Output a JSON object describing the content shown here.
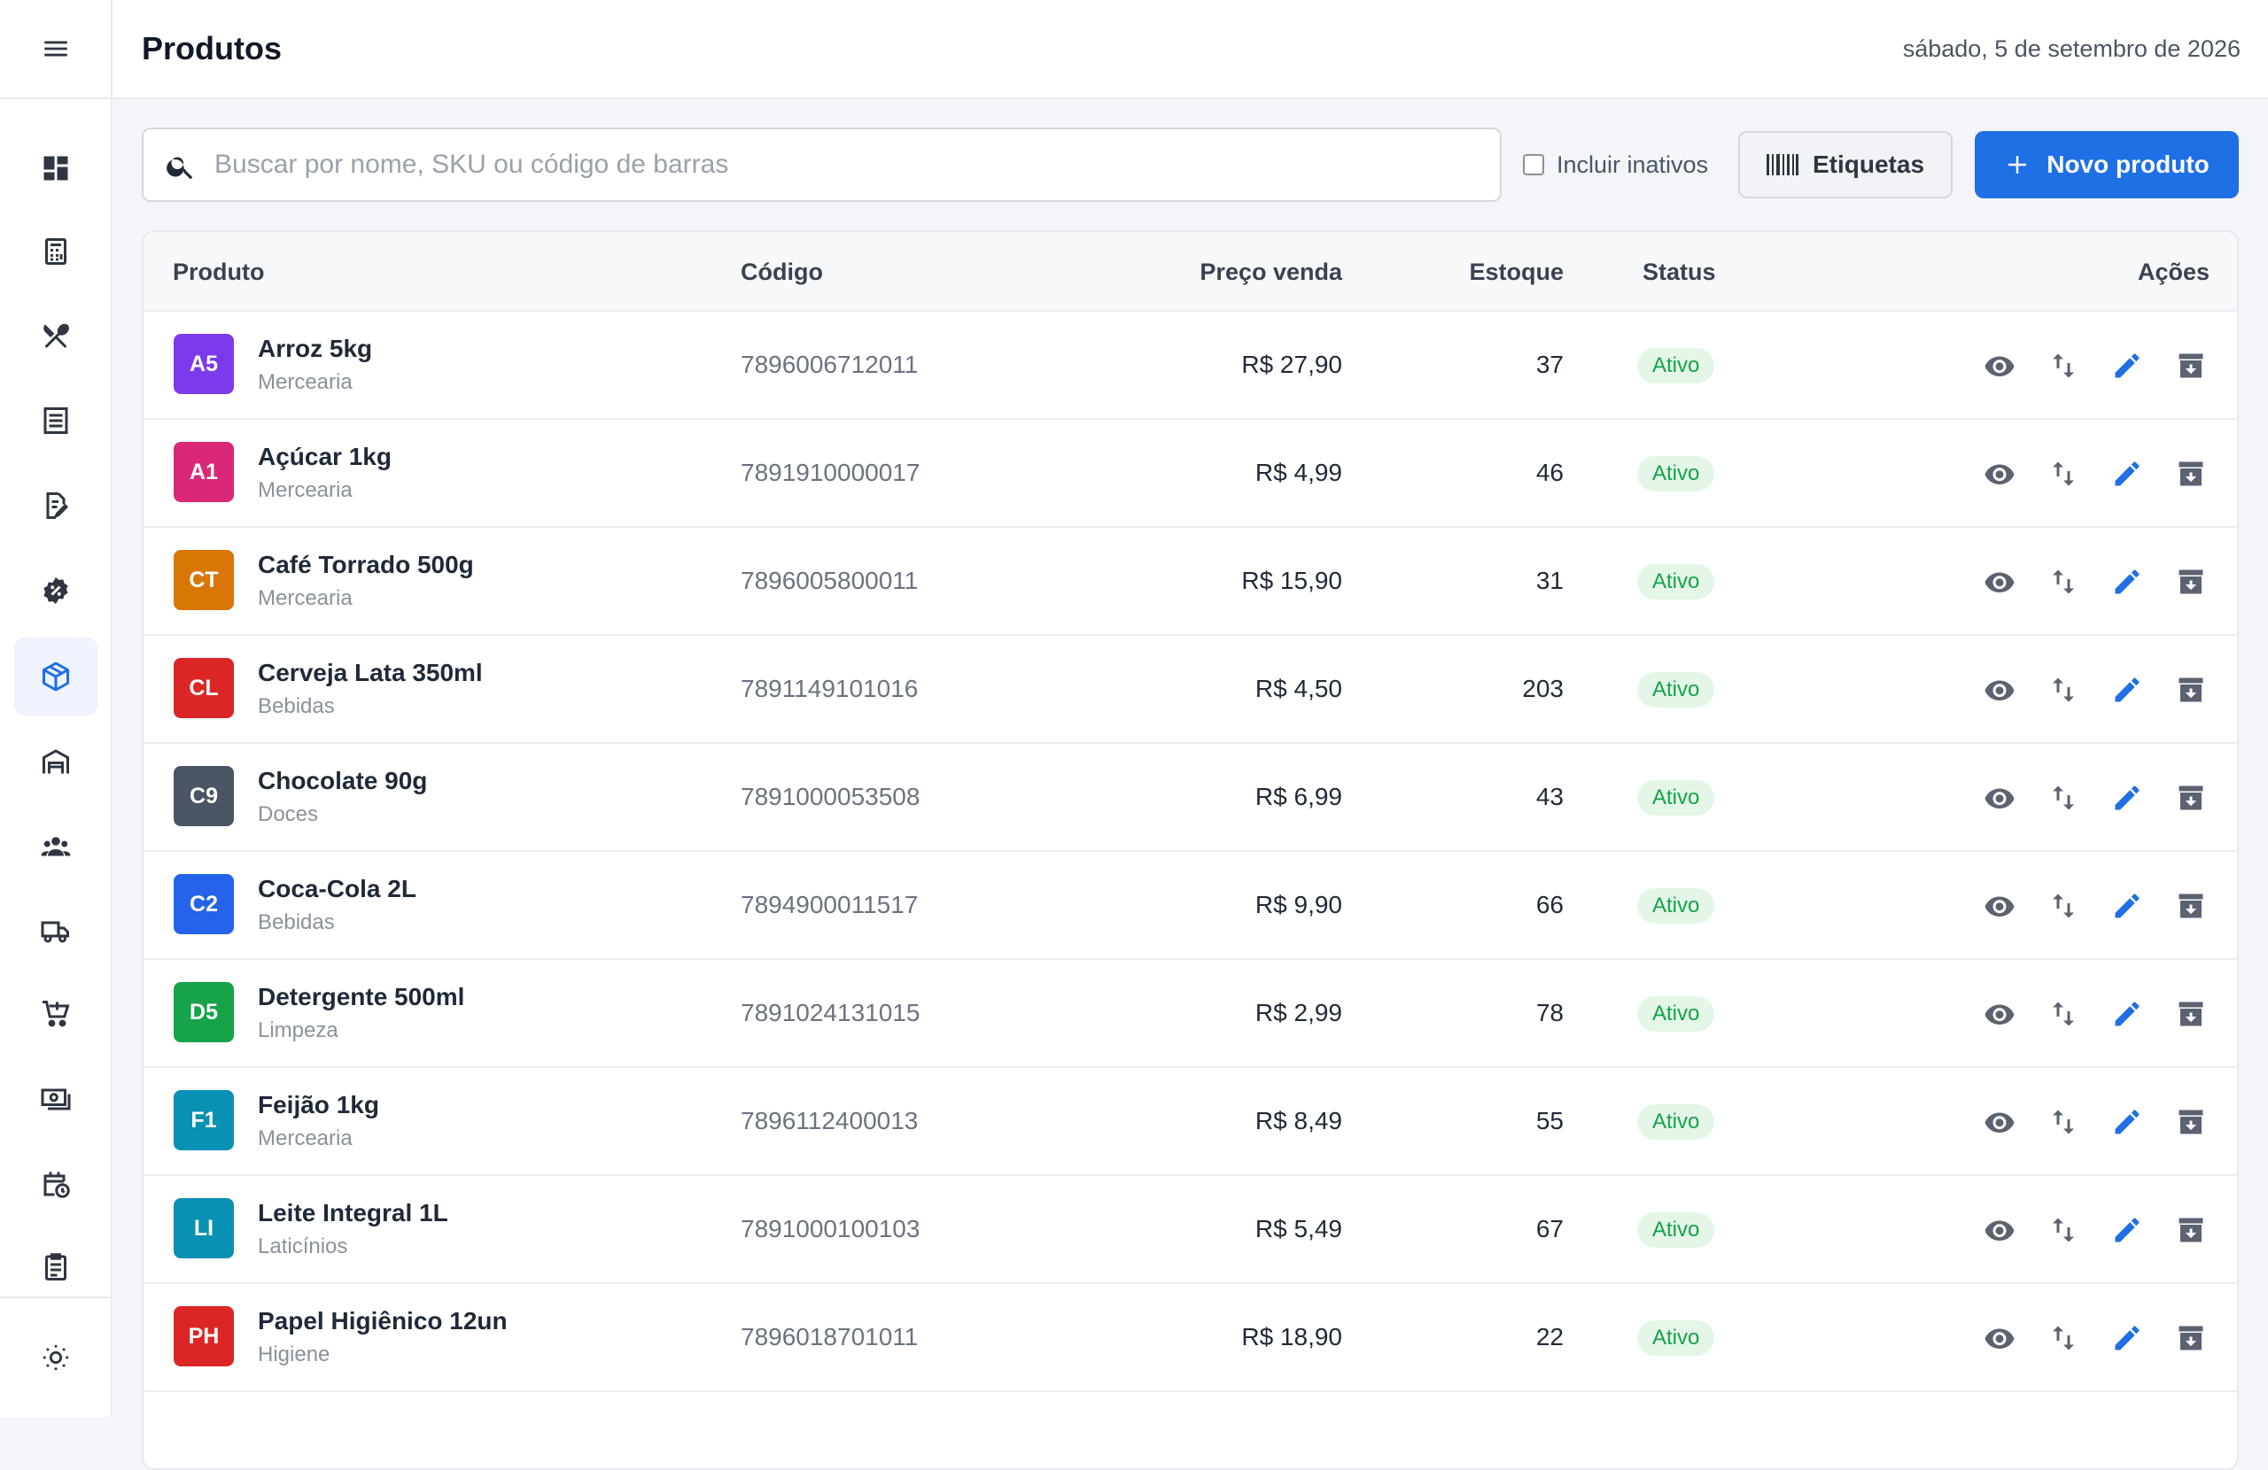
{
  "header": {
    "title": "Produtos",
    "date": "sábado, 5 de setembro de 2026"
  },
  "sidebar": {
    "items": [
      {
        "icon": "dashboard-icon"
      },
      {
        "icon": "calculator-icon"
      },
      {
        "icon": "restaurant-icon"
      },
      {
        "icon": "list-icon"
      },
      {
        "icon": "edit-document-icon"
      },
      {
        "icon": "discount-badge-icon"
      },
      {
        "icon": "box-icon",
        "active": true
      },
      {
        "icon": "warehouse-icon"
      },
      {
        "icon": "users-icon"
      },
      {
        "icon": "truck-icon"
      },
      {
        "icon": "cart-add-icon"
      },
      {
        "icon": "cash-icon"
      },
      {
        "icon": "calendar-clock-icon"
      },
      {
        "icon": "clipboard-icon"
      }
    ],
    "bottom_icon": "theme-sun-icon"
  },
  "toolbar": {
    "search_placeholder": "Buscar por nome, SKU ou código de barras",
    "include_inactive_label": "Incluir inativos",
    "labels_button": "Etiquetas",
    "new_product_button": "Novo produto"
  },
  "table": {
    "columns": {
      "product": "Produto",
      "code": "Código",
      "price": "Preço venda",
      "stock": "Estoque",
      "status": "Status",
      "actions": "Ações"
    },
    "rows": [
      {
        "initials": "A5",
        "color": "#7c3aed",
        "name": "Arroz 5kg",
        "category": "Mercearia",
        "code": "7896006712011",
        "price": "R$ 27,90",
        "stock": "37",
        "status": "Ativo"
      },
      {
        "initials": "A1",
        "color": "#db2777",
        "name": "Açúcar 1kg",
        "category": "Mercearia",
        "code": "7891910000017",
        "price": "R$ 4,99",
        "stock": "46",
        "status": "Ativo"
      },
      {
        "initials": "CT",
        "color": "#d97706",
        "name": "Café Torrado 500g",
        "category": "Mercearia",
        "code": "7896005800011",
        "price": "R$ 15,90",
        "stock": "31",
        "status": "Ativo"
      },
      {
        "initials": "CL",
        "color": "#dc2626",
        "name": "Cerveja Lata 350ml",
        "category": "Bebidas",
        "code": "7891149101016",
        "price": "R$ 4,50",
        "stock": "203",
        "status": "Ativo"
      },
      {
        "initials": "C9",
        "color": "#4b5563",
        "name": "Chocolate 90g",
        "category": "Doces",
        "code": "7891000053508",
        "price": "R$ 6,99",
        "stock": "43",
        "status": "Ativo"
      },
      {
        "initials": "C2",
        "color": "#2563eb",
        "name": "Coca-Cola 2L",
        "category": "Bebidas",
        "code": "7894900011517",
        "price": "R$ 9,90",
        "stock": "66",
        "status": "Ativo"
      },
      {
        "initials": "D5",
        "color": "#16a34a",
        "name": "Detergente 500ml",
        "category": "Limpeza",
        "code": "7891024131015",
        "price": "R$ 2,99",
        "stock": "78",
        "status": "Ativo"
      },
      {
        "initials": "F1",
        "color": "#0891b2",
        "name": "Feijão 1kg",
        "category": "Mercearia",
        "code": "7896112400013",
        "price": "R$ 8,49",
        "stock": "55",
        "status": "Ativo"
      },
      {
        "initials": "LI",
        "color": "#0891b2",
        "name": "Leite Integral 1L",
        "category": "Laticínios",
        "code": "7891000100103",
        "price": "R$ 5,49",
        "stock": "67",
        "status": "Ativo"
      },
      {
        "initials": "PH",
        "color": "#dc2626",
        "name": "Papel Higiênico 12un",
        "category": "Higiene",
        "code": "7896018701011",
        "price": "R$ 18,90",
        "stock": "22",
        "status": "Ativo"
      }
    ]
  },
  "colors": {
    "accent": "#1f6fe5",
    "status_active_bg": "#e3f6e8",
    "status_active_text": "#16a34a"
  }
}
